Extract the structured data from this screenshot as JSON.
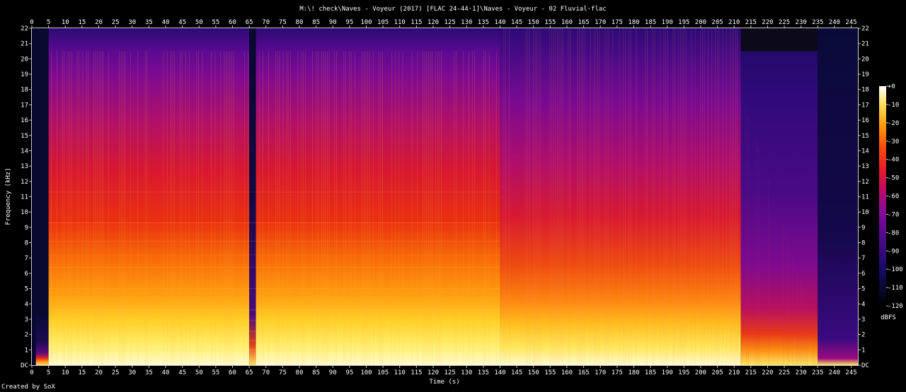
{
  "chart_data": {
    "type": "heatmap",
    "title": "M:\\! check\\Naves - Voyeur (2017) [FLAC 24-44·1]\\Naves - Voyeur - 02 Fluvial·flac",
    "xlabel": "Time (s)",
    "ylabel": "Frequency (kHz)",
    "xlim": [
      0,
      247
    ],
    "ylim": [
      0,
      22
    ],
    "x_ticks": [
      0,
      5,
      10,
      15,
      20,
      25,
      30,
      35,
      40,
      45,
      50,
      55,
      60,
      65,
      70,
      75,
      80,
      85,
      90,
      95,
      100,
      105,
      110,
      115,
      120,
      125,
      130,
      135,
      140,
      145,
      150,
      155,
      160,
      165,
      170,
      175,
      180,
      185,
      190,
      195,
      200,
      205,
      210,
      215,
      220,
      225,
      230,
      235,
      240,
      245
    ],
    "y_ticks": [
      "DC",
      "1",
      "2",
      "3",
      "4",
      "5",
      "6",
      "7",
      "8",
      "9",
      "10",
      "11",
      "12",
      "13",
      "14",
      "15",
      "16",
      "17",
      "18",
      "19",
      "20",
      "21",
      "22"
    ],
    "colorbar": {
      "label": "dBFS",
      "ticks": [
        "+0",
        "-10",
        "-20",
        "-30",
        "-40",
        "-50",
        "-60",
        "-70",
        "-80",
        "-90",
        "-100",
        "-110",
        "-120"
      ],
      "range": [
        -120,
        0
      ]
    },
    "segments": [
      {
        "start": 0,
        "end": 1.2,
        "level": "silence"
      },
      {
        "start": 1.2,
        "end": 5,
        "level": "intro",
        "cutoff_khz": 3.2
      },
      {
        "start": 5,
        "end": 65,
        "level": "loud",
        "cutoff_khz": 20.5
      },
      {
        "start": 65,
        "end": 67,
        "level": "gap"
      },
      {
        "start": 67,
        "end": 140,
        "level": "loud",
        "cutoff_khz": 20.5
      },
      {
        "start": 140,
        "end": 212,
        "level": "medium",
        "cutoff_khz": 22
      },
      {
        "start": 212,
        "end": 235,
        "level": "fade",
        "cutoff_khz": 20.5
      },
      {
        "start": 235,
        "end": 247,
        "level": "tail"
      }
    ],
    "grid": false,
    "legend": "right"
  },
  "footer": {
    "credit": "Created by SoX"
  }
}
